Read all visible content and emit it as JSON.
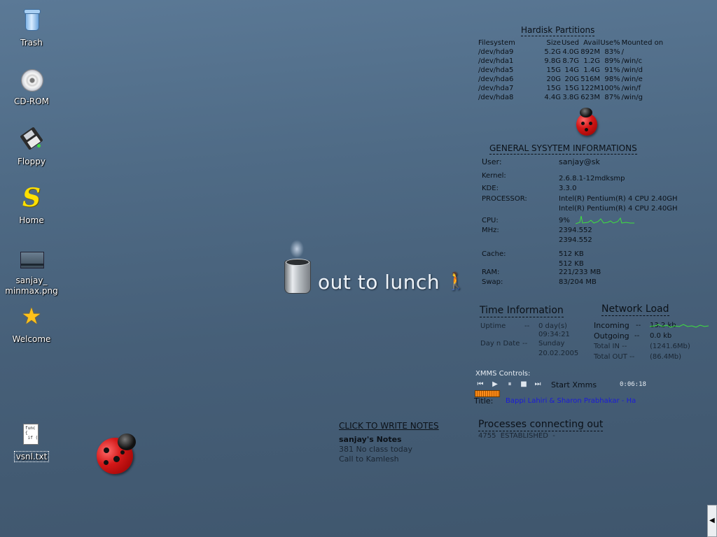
{
  "desktop_icons": {
    "trash": "Trash",
    "cdrom": "CD-ROM",
    "floppy": "Floppy",
    "home": "Home",
    "image_line1": "sanjay_",
    "image_line2": "minmax.png",
    "welcome": "Welcome",
    "textfile": "vsnl.txt",
    "home_glyph": "S",
    "textfile_preview": "func\n{\n if (\n"
  },
  "lunch": {
    "text": "out to lunch",
    "walker_glyph": "🚶"
  },
  "disk": {
    "title": "Hardisk Partitions",
    "headers": [
      "Filesystem",
      "Size",
      "Used",
      "Avail",
      "Use%",
      "Mounted on"
    ],
    "rows": [
      [
        "/dev/hda9",
        "5.2G",
        "4.0G",
        "892M",
        "83%",
        "/"
      ],
      [
        "/dev/hda1",
        "9.8G",
        "8.7G",
        "1.2G",
        "89%",
        "/win/c"
      ],
      [
        "/dev/hda5",
        "15G",
        "14G",
        "1.4G",
        "91%",
        "/win/d"
      ],
      [
        "/dev/hda6",
        "20G",
        "20G",
        "516M",
        "98%",
        "/win/e"
      ],
      [
        "/dev/hda7",
        "15G",
        "15G",
        "122M",
        "100%",
        "/win/f"
      ],
      [
        "/dev/hda8",
        "4.4G",
        "3.8G",
        "623M",
        "87%",
        "/win/g"
      ]
    ]
  },
  "sysinfo": {
    "title": "GENERAL SYSYTEM INFORMATIONS",
    "user_label": "User:",
    "user": "sanjay@sk",
    "kernel_label": "Kernel:",
    "kernel": "2.6.8.1-12mdksmp",
    "kde_label": "KDE:",
    "kde": "3.3.0",
    "proc_label": "PROCESSOR:",
    "proc1": "Intel(R) Pentium(R) 4 CPU 2.40GH",
    "proc2": "Intel(R) Pentium(R) 4 CPU 2.40GH",
    "cpu_label": "CPU:",
    "cpu": "9%",
    "mhz_label": "MHz:",
    "mhz1": "2394.552",
    "mhz2": "2394.552",
    "cache_label": "Cache:",
    "cache1": "512 KB",
    "cache2": "512 KB",
    "ram_label": "RAM:",
    "ram": "221/233 MB",
    "swap_label": "Swap:",
    "swap": "83/204 MB"
  },
  "time": {
    "title": "Time Information",
    "uptime_label": "Uptime",
    "sep": "--",
    "uptime1": "0 day(s)",
    "uptime2": "09:34:21",
    "date_label": "Day n Date",
    "date1": "Sunday",
    "date2": "20.02.2005"
  },
  "network": {
    "title": "Network Load",
    "in_label": "Incoming",
    "in_value": "13.2 kb",
    "out_label": "Outgoing",
    "out_value": "0.0 kb",
    "total_in_label": "Total IN --",
    "total_in": "(1241.6Mb)",
    "total_out_label": "Total OUT --",
    "total_out": "(86.4Mb)"
  },
  "xmms": {
    "label": "XMMS Controls:",
    "start": "Start Xmms",
    "time": "0:06:18",
    "title_label": "Title:",
    "title": "Bappi Lahiri & Sharon Prabhakar - Ha"
  },
  "notes": {
    "header": "CLICK TO WRITE NOTES",
    "title": "sanjay's Notes",
    "line1": "381 No class today",
    "line2": "Call to Kamlesh"
  },
  "processes": {
    "title": "Processes connecting out",
    "line": "4755  ESTABLISHED  -"
  },
  "colors": {
    "accent_blue": "#1b1bd8",
    "graph_green": "#3ee03e",
    "xmms_orange": "#ff8c1a"
  }
}
